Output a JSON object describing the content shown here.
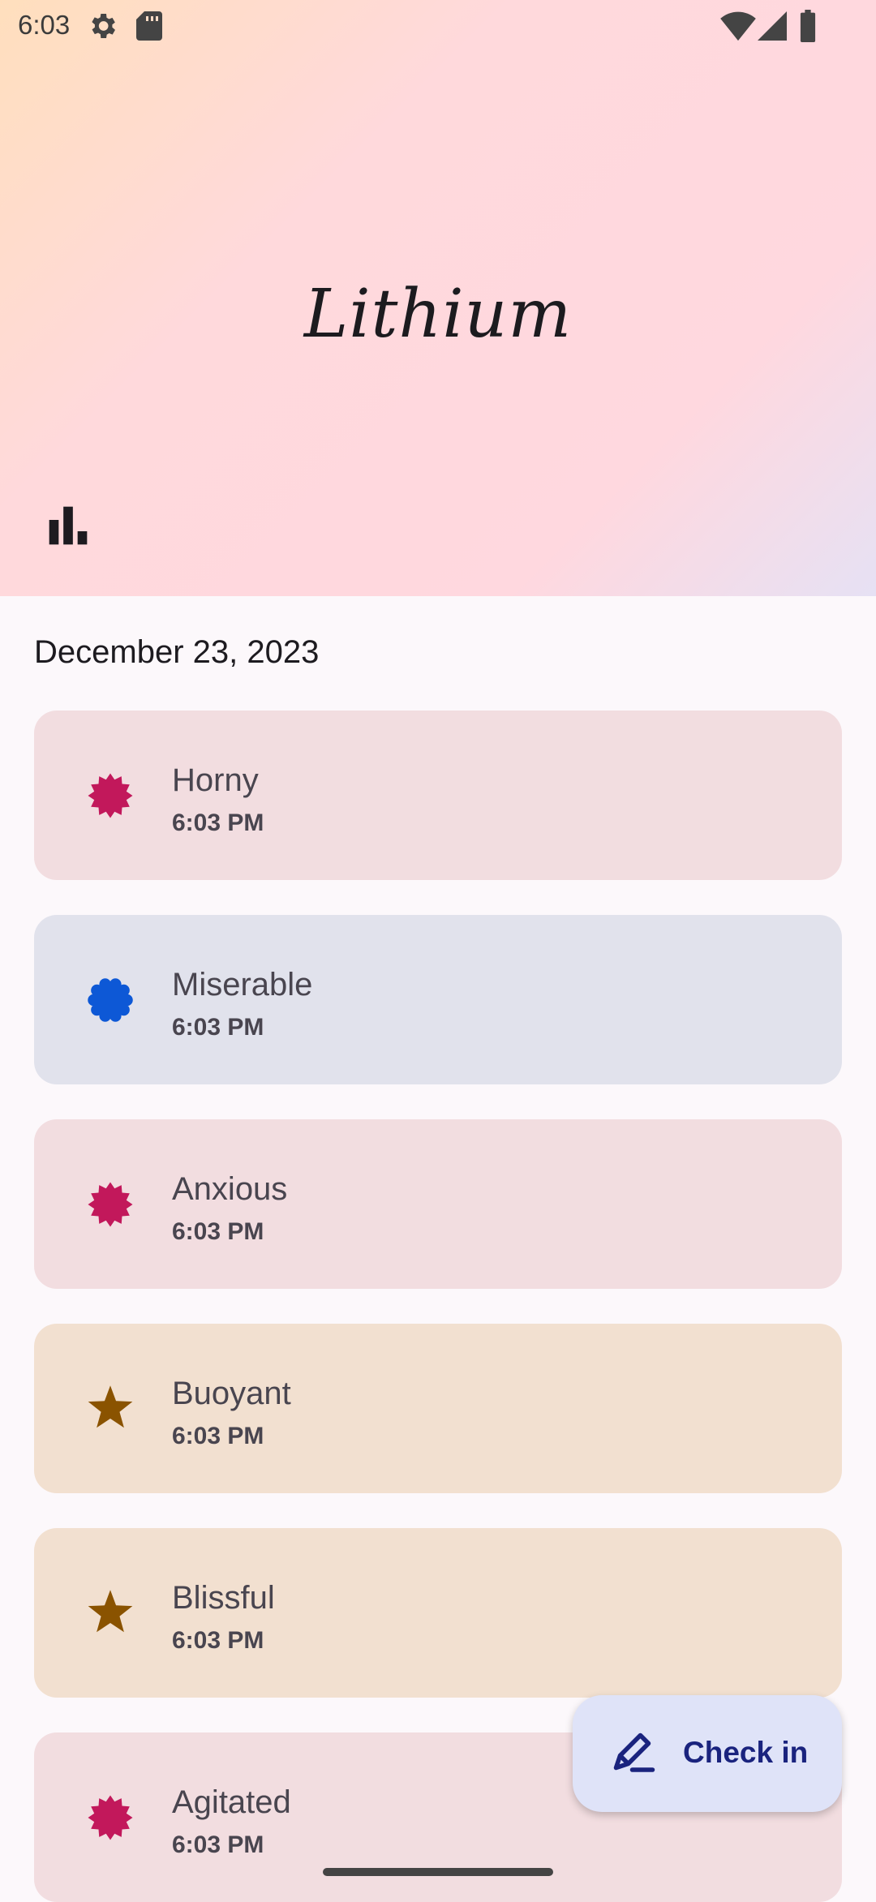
{
  "status_bar": {
    "time": "6:03",
    "icons": [
      "settings-icon",
      "sd-card-icon",
      "wifi-icon",
      "signal-icon",
      "battery-icon"
    ]
  },
  "app": {
    "title": "Lithium"
  },
  "header": {
    "stats_icon": "bar-chart-icon"
  },
  "date_heading": "December 23, 2023",
  "entries": [
    {
      "mood": "Horny",
      "time": "6:03 PM",
      "icon": "burst-icon",
      "icon_color": "#c2185b",
      "card_color": "#f2dde0"
    },
    {
      "mood": "Miserable",
      "time": "6:03 PM",
      "icon": "flower-icon",
      "icon_color": "#0d58d6",
      "card_color": "#e1e2ec"
    },
    {
      "mood": "Anxious",
      "time": "6:03 PM",
      "icon": "burst-icon",
      "icon_color": "#c2185b",
      "card_color": "#f2dde0"
    },
    {
      "mood": "Buoyant",
      "time": "6:03 PM",
      "icon": "star-icon",
      "icon_color": "#8a5300",
      "card_color": "#f2e0d0"
    },
    {
      "mood": "Blissful",
      "time": "6:03 PM",
      "icon": "star-icon",
      "icon_color": "#8a5300",
      "card_color": "#f2e0d0"
    },
    {
      "mood": "Agitated",
      "time": "6:03 PM",
      "icon": "burst-icon",
      "icon_color": "#c2185b",
      "card_color": "#f2dde0"
    }
  ],
  "fab": {
    "label": "Check in",
    "icon": "edit-pen-icon"
  }
}
